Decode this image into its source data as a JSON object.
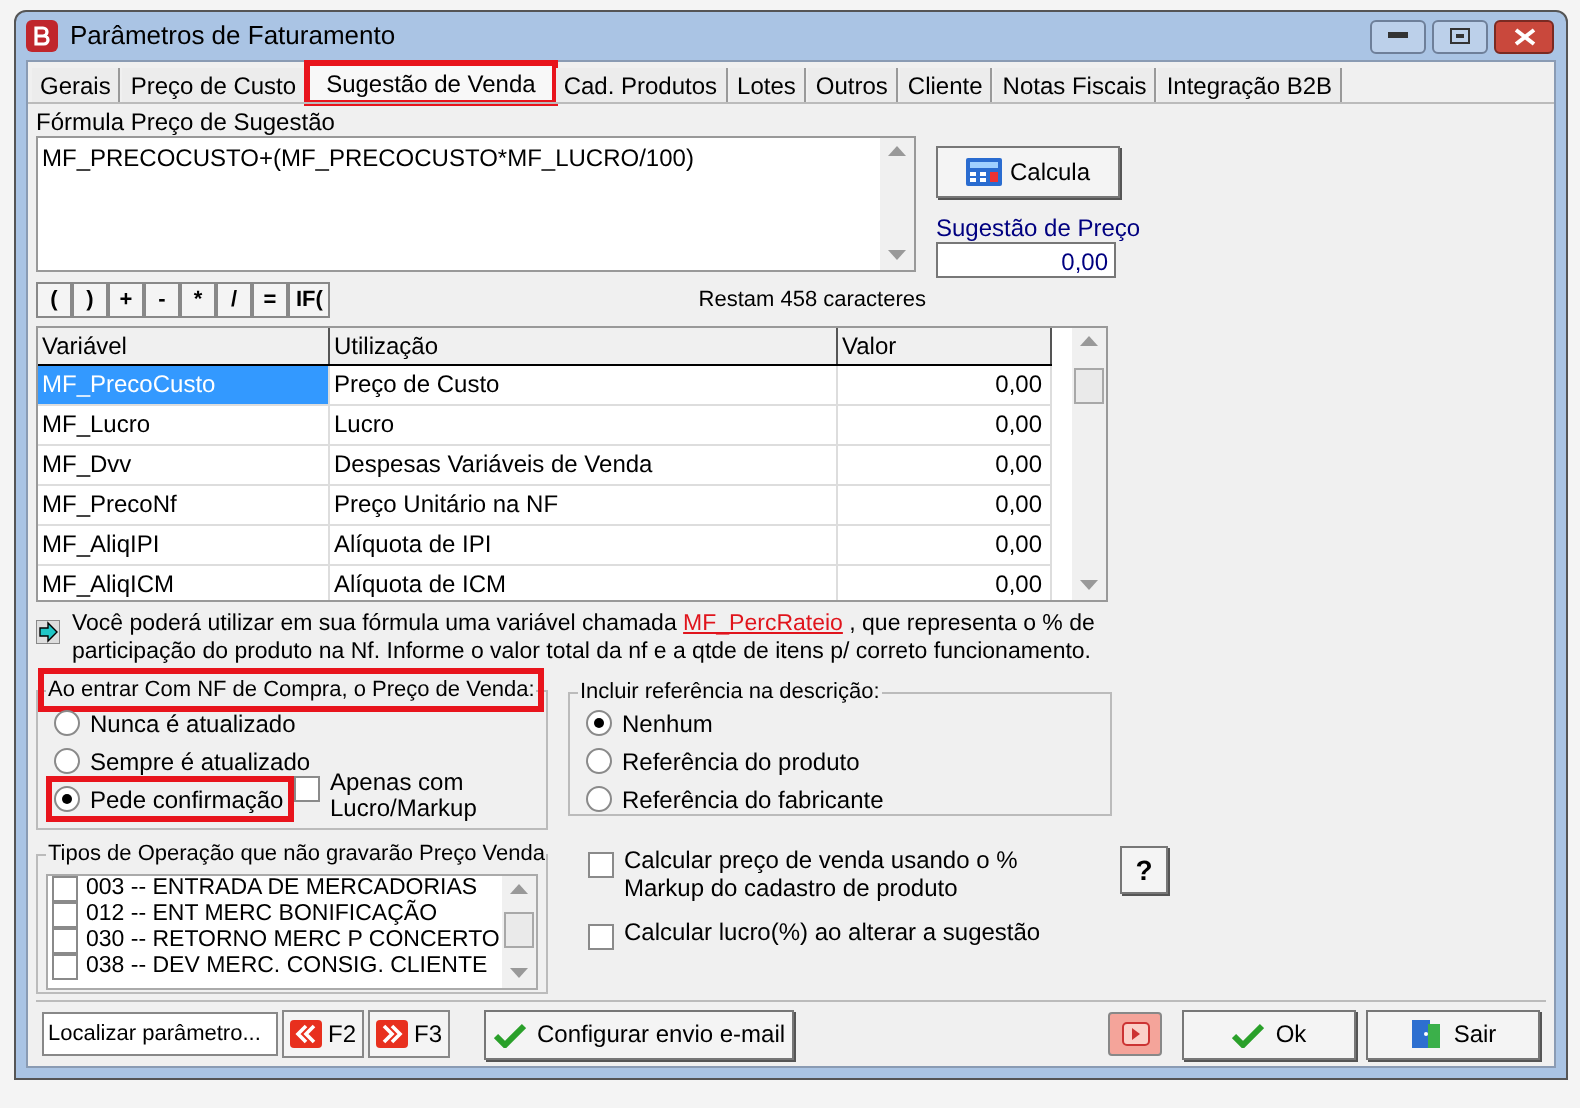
{
  "window": {
    "title": "Parâmetros de Faturamento"
  },
  "tabs": [
    {
      "label": "Gerais",
      "selected": false,
      "highlighted": false
    },
    {
      "label": "Preço de Custo",
      "selected": false,
      "highlighted": false
    },
    {
      "label": "Sugestão de  Venda",
      "selected": true,
      "highlighted": true
    },
    {
      "label": "Cad. Produtos",
      "selected": false,
      "highlighted": false
    },
    {
      "label": "Lotes",
      "selected": false,
      "highlighted": false
    },
    {
      "label": "Outros",
      "selected": false,
      "highlighted": false
    },
    {
      "label": "Cliente",
      "selected": false,
      "highlighted": false
    },
    {
      "label": "Notas Fiscais",
      "selected": false,
      "highlighted": false
    },
    {
      "label": "Integração B2B",
      "selected": false,
      "highlighted": false
    }
  ],
  "formula": {
    "label": "Fórmula Preço de Sugestão",
    "value": "MF_PRECOCUSTO+(MF_PRECOCUSTO*MF_LUCRO/100)"
  },
  "calc_button": "Calcula",
  "suggestion": {
    "label": "Sugestão de Preço",
    "value": "0,00"
  },
  "operators": [
    "(",
    ")",
    "+",
    "-",
    "*",
    "/",
    "=",
    "IF("
  ],
  "remaining": "Restam 458 caracteres",
  "table": {
    "columns": [
      "Variável",
      "Utilização",
      "Valor"
    ],
    "rows": [
      {
        "cells": [
          "MF_PrecoCusto",
          "Preço de Custo",
          "0,00"
        ],
        "selected": true
      },
      {
        "cells": [
          "MF_Lucro",
          "Lucro",
          "0,00"
        ],
        "selected": false
      },
      {
        "cells": [
          "MF_Dvv",
          "Despesas Variáveis de Venda",
          "0,00"
        ],
        "selected": false
      },
      {
        "cells": [
          "MF_PrecoNf",
          "Preço Unitário na NF",
          "0,00"
        ],
        "selected": false
      },
      {
        "cells": [
          "MF_AliqIPI",
          "Alíquota de IPI",
          "0,00"
        ],
        "selected": false
      },
      {
        "cells": [
          "MF_AliqICM",
          "Alíquota de ICM",
          "0,00"
        ],
        "selected": false
      }
    ]
  },
  "info": {
    "before": "Você poderá utilizar em sua fórmula uma variável chamada",
    "link": "MF_PercRateio",
    "after": ", que representa o % de participação do produto na Nf. Informe o valor total da nf e a qtde de itens p/ correto funcionamento."
  },
  "update_group": {
    "legend": "Ao entrar Com NF de Compra, o Preço de Venda:",
    "highlighted": true,
    "options": [
      {
        "label": "Nunca é atualizado",
        "selected": false,
        "highlighted": false
      },
      {
        "label": "Sempre é atualizado",
        "selected": false,
        "highlighted": false
      },
      {
        "label": "Pede confirmação",
        "selected": true,
        "highlighted": true
      }
    ],
    "only_markup": {
      "label": "Apenas com Lucro/Markup",
      "checked": false
    }
  },
  "reference_group": {
    "legend": "Incluir referência na descrição:",
    "options": [
      {
        "label": "Nenhum",
        "selected": true
      },
      {
        "label": "Referência do produto",
        "selected": false
      },
      {
        "label": "Referência do fabricante",
        "selected": false
      }
    ]
  },
  "operation_types": {
    "legend": "Tipos de Operação que não gravarão Preço Venda",
    "items": [
      {
        "label": "003 -- ENTRADA DE MERCADORIAS",
        "checked": false
      },
      {
        "label": "012 -- ENT MERC BONIFICAÇÃO",
        "checked": false
      },
      {
        "label": "030 -- RETORNO  MERC P CONCERTO",
        "checked": false
      },
      {
        "label": "038 -- DEV MERC. CONSIG. CLIENTE",
        "checked": false
      }
    ]
  },
  "options": [
    {
      "label": "Calcular preço de venda usando o % Markup do cadastro de produto",
      "checked": false,
      "help": "?"
    },
    {
      "label": "Calcular lucro(%) ao alterar a sugestão",
      "checked": false
    }
  ],
  "footer": {
    "search": {
      "value": "Localizar parâmetro..."
    },
    "prev": "F2",
    "next": "F3",
    "email_button": "Configurar envio e-mail",
    "ok_button": "Ok",
    "exit_button": "Sair"
  }
}
